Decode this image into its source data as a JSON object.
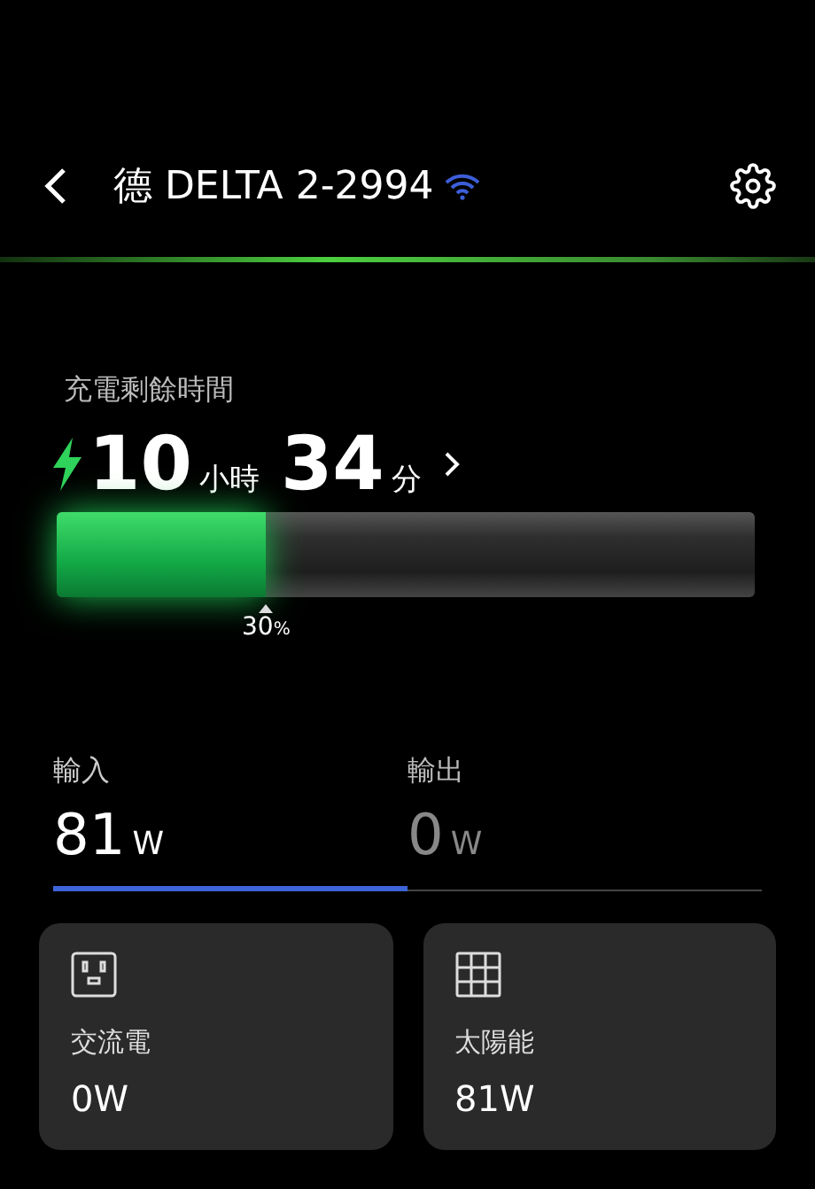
{
  "header": {
    "title": "德 DELTA 2-2994",
    "wifi": true
  },
  "charging": {
    "label": "充電剩餘時間",
    "hours": "10",
    "hours_unit": "小時",
    "minutes": "34",
    "minutes_unit": "分",
    "level": 0.3,
    "percent": "30",
    "percent_sign": "%"
  },
  "tabs": [
    {
      "label": "輸入",
      "value": "81",
      "unit": "W",
      "selected": true
    },
    {
      "label": "輸出",
      "value": "0",
      "unit": "W",
      "selected": false
    }
  ],
  "sources": [
    {
      "kind": "ac",
      "label": "交流電",
      "value": "0W"
    },
    {
      "kind": "solar",
      "label": "太陽能",
      "value": "81W"
    }
  ]
}
